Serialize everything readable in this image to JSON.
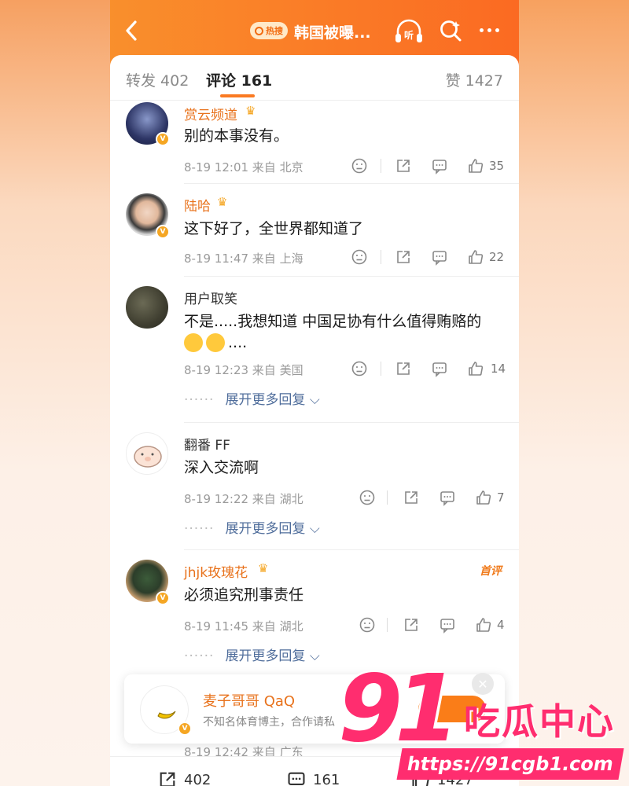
{
  "header": {
    "hot_label": "热搜",
    "title": "韩国被曝...",
    "listen_label": "听"
  },
  "tabs": {
    "repost": "转发 402",
    "comment": "评论 161",
    "like": "赞 1427"
  },
  "comments": [
    {
      "user": "赏云频道",
      "text": "别的本事没有。",
      "meta": "8-19 12:01 来自 北京",
      "likes": "35"
    },
    {
      "user": "陆哈",
      "text": "这下好了，全世界都知道了",
      "meta": "8-19 11:47 来自 上海",
      "likes": "22"
    },
    {
      "user": "用户取笑",
      "text": "不是.....我想知道 中国足协有什么值得贿赂的",
      "text2": "....",
      "meta": "8-19 12:23 来自 美国",
      "likes": "14",
      "more": "展开更多回复"
    },
    {
      "user": "翻番 FF",
      "text": "深入交流啊",
      "meta": "8-19 12:22 来自 湖北",
      "likes": "7",
      "more": "展开更多回复"
    },
    {
      "user": "jhjk玫瑰花",
      "text": "必须追究刑事责任",
      "meta": "8-19 11:45 来自 湖北",
      "likes": "4",
      "more": "展开更多回复",
      "tag": "首评"
    }
  ],
  "popup": {
    "name": "麦子哥哥 QaQ",
    "desc": "不知名体育博主，合作请私"
  },
  "last_meta": "8-19 12:42 来自 广东",
  "bottom": {
    "repost": "402",
    "comment": "161",
    "like": "1427"
  },
  "watermark": {
    "big": "91",
    "title": "吃瓜中心",
    "url": "https://91cgb1.com"
  },
  "colors": {
    "accent": "#fa7a22",
    "gold_name": "#e8721c",
    "link": "#4f6d9b",
    "watermark": "#ff2d6f"
  }
}
